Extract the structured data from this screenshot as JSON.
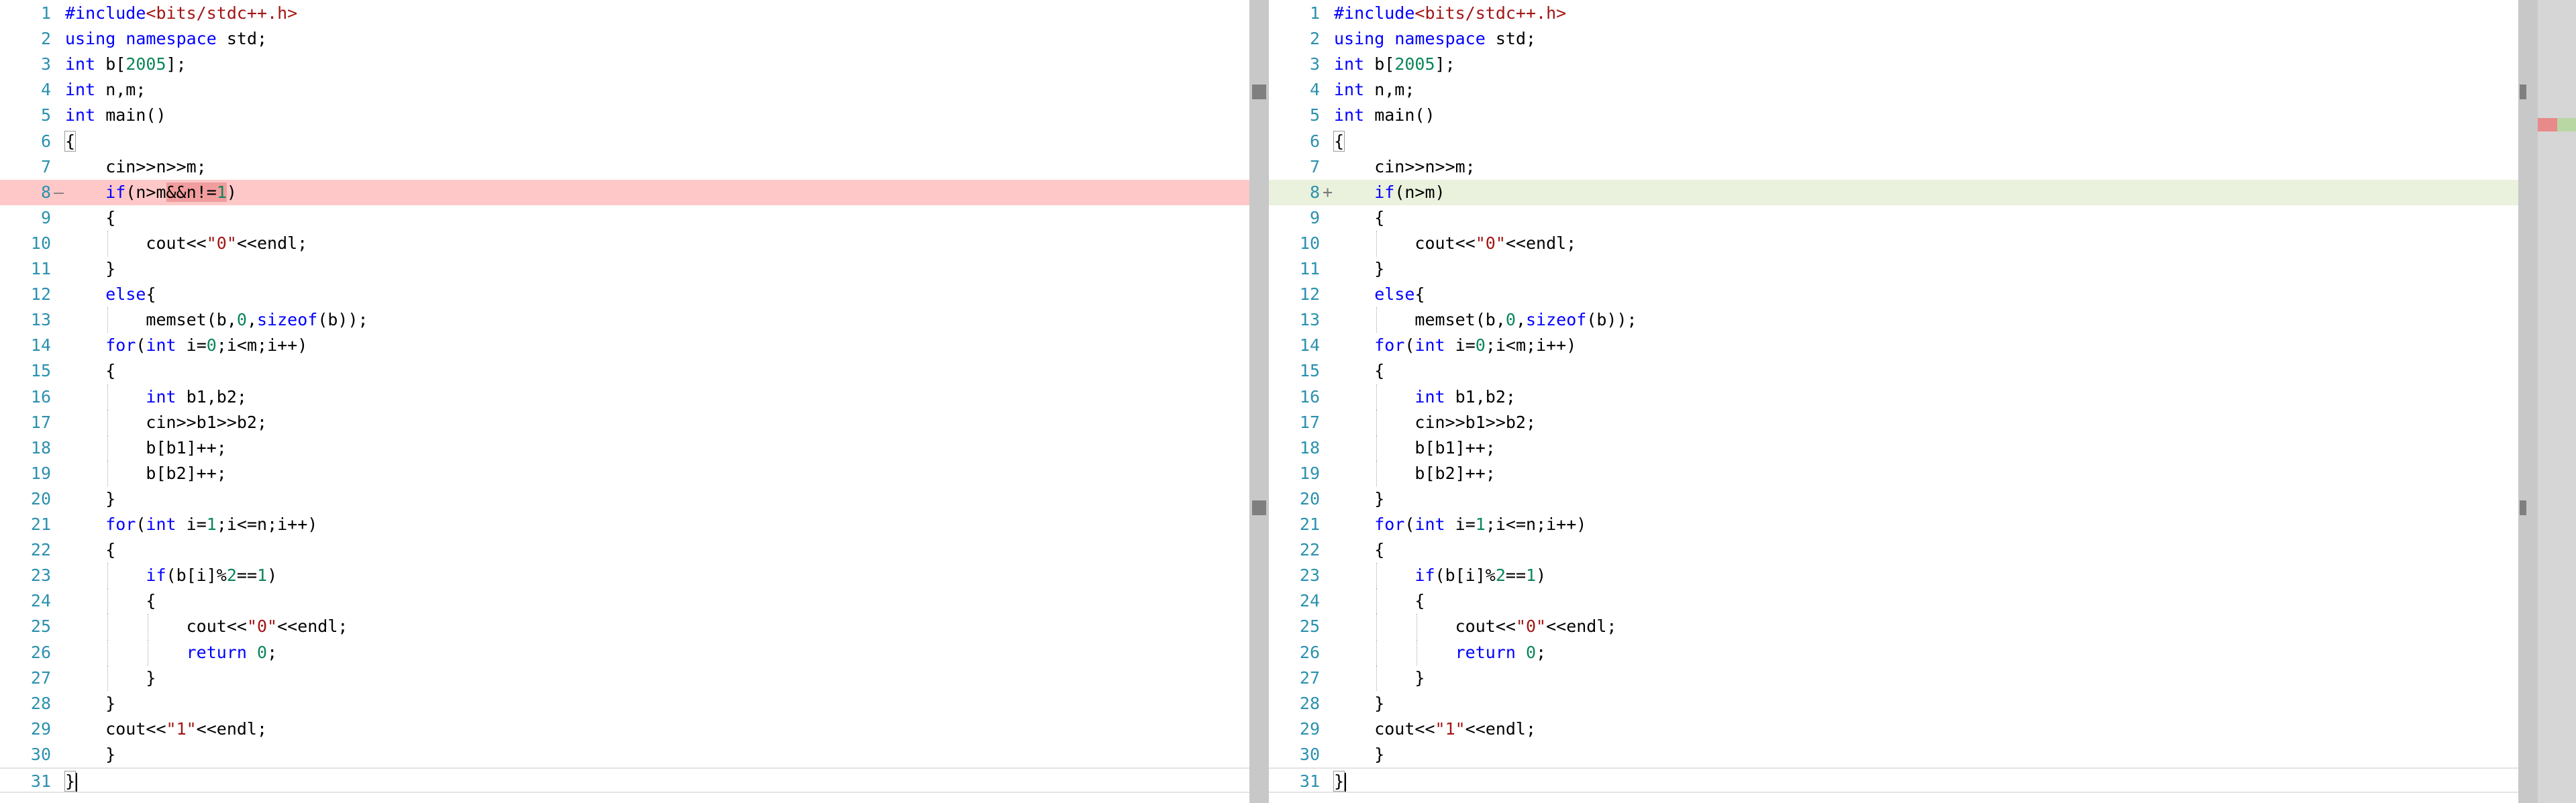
{
  "colors": {
    "line_number": "#2b91af",
    "keyword": "#0000ff",
    "string": "#a31515",
    "number": "#098658",
    "deleted_line_bg": "#ffc8c8",
    "deleted_text_bg": "#f19d9d",
    "added_line_bg": "#eaf1dc",
    "scrollbar": "#c8c8c8",
    "overview_ruler": "#d6d6d6"
  },
  "left": {
    "lines": [
      {
        "n": "1",
        "t": "#include<bits/stdc++.h>"
      },
      {
        "n": "2",
        "t": "using namespace std;"
      },
      {
        "n": "3",
        "t": "int b[2005];"
      },
      {
        "n": "4",
        "t": "int n,m;"
      },
      {
        "n": "5",
        "t": "int main()"
      },
      {
        "n": "6",
        "t": "{"
      },
      {
        "n": "7",
        "t": "    cin>>n>>m;"
      },
      {
        "n": "8",
        "t": "    if(n>m&&n!=1)",
        "marker": "—"
      },
      {
        "n": "9",
        "t": "    {"
      },
      {
        "n": "10",
        "t": "        cout<<\"0\"<<endl;"
      },
      {
        "n": "11",
        "t": "    }"
      },
      {
        "n": "12",
        "t": "    else{"
      },
      {
        "n": "13",
        "t": "        memset(b,0,sizeof(b));"
      },
      {
        "n": "14",
        "t": "    for(int i=0;i<m;i++)"
      },
      {
        "n": "15",
        "t": "    {"
      },
      {
        "n": "16",
        "t": "        int b1,b2;"
      },
      {
        "n": "17",
        "t": "        cin>>b1>>b2;"
      },
      {
        "n": "18",
        "t": "        b[b1]++;"
      },
      {
        "n": "19",
        "t": "        b[b2]++;"
      },
      {
        "n": "20",
        "t": "    }"
      },
      {
        "n": "21",
        "t": "    for(int i=1;i<=n;i++)"
      },
      {
        "n": "22",
        "t": "    {"
      },
      {
        "n": "23",
        "t": "        if(b[i]%2==1)"
      },
      {
        "n": "24",
        "t": "        {"
      },
      {
        "n": "25",
        "t": "            cout<<\"0\"<<endl;"
      },
      {
        "n": "26",
        "t": "            return 0;"
      },
      {
        "n": "27",
        "t": "        }"
      },
      {
        "n": "28",
        "t": "    }"
      },
      {
        "n": "29",
        "t": "    cout<<\"1\"<<endl;"
      },
      {
        "n": "30",
        "t": "    }"
      },
      {
        "n": "31",
        "t": "}"
      }
    ]
  },
  "right": {
    "lines": [
      {
        "n": "1",
        "t": "#include<bits/stdc++.h>"
      },
      {
        "n": "2",
        "t": "using namespace std;"
      },
      {
        "n": "3",
        "t": "int b[2005];"
      },
      {
        "n": "4",
        "t": "int n,m;"
      },
      {
        "n": "5",
        "t": "int main()"
      },
      {
        "n": "6",
        "t": "{"
      },
      {
        "n": "7",
        "t": "    cin>>n>>m;"
      },
      {
        "n": "8",
        "t": "    if(n>m)",
        "marker": "+"
      },
      {
        "n": "9",
        "t": "    {"
      },
      {
        "n": "10",
        "t": "        cout<<\"0\"<<endl;"
      },
      {
        "n": "11",
        "t": "    }"
      },
      {
        "n": "12",
        "t": "    else{"
      },
      {
        "n": "13",
        "t": "        memset(b,0,sizeof(b));"
      },
      {
        "n": "14",
        "t": "    for(int i=0;i<m;i++)"
      },
      {
        "n": "15",
        "t": "    {"
      },
      {
        "n": "16",
        "t": "        int b1,b2;"
      },
      {
        "n": "17",
        "t": "        cin>>b1>>b2;"
      },
      {
        "n": "18",
        "t": "        b[b1]++;"
      },
      {
        "n": "19",
        "t": "        b[b2]++;"
      },
      {
        "n": "20",
        "t": "    }"
      },
      {
        "n": "21",
        "t": "    for(int i=1;i<=n;i++)"
      },
      {
        "n": "22",
        "t": "    {"
      },
      {
        "n": "23",
        "t": "        if(b[i]%2==1)"
      },
      {
        "n": "24",
        "t": "        {"
      },
      {
        "n": "25",
        "t": "            cout<<\"0\"<<endl;"
      },
      {
        "n": "26",
        "t": "            return 0;"
      },
      {
        "n": "27",
        "t": "        }"
      },
      {
        "n": "28",
        "t": "    }"
      },
      {
        "n": "29",
        "t": "    cout<<\"1\"<<endl;"
      },
      {
        "n": "30",
        "t": "    }"
      },
      {
        "n": "31",
        "t": "}"
      }
    ]
  }
}
